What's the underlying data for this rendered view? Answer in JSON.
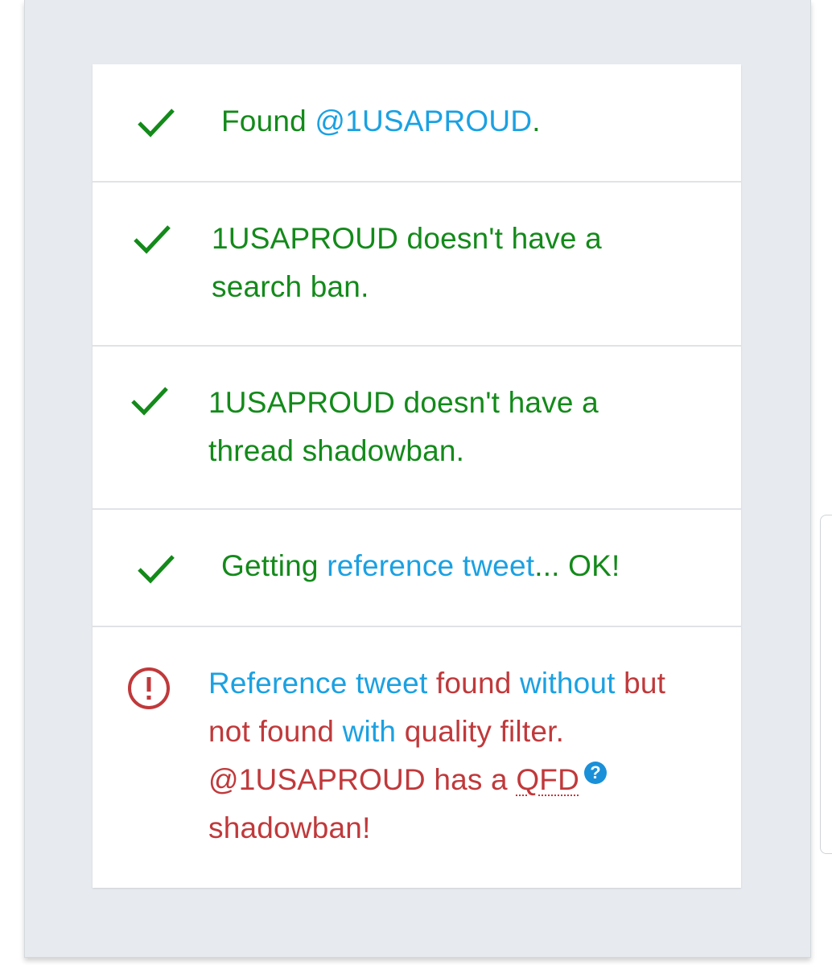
{
  "results": [
    {
      "status": "ok",
      "icon": "check-icon",
      "parts": [
        {
          "text": "Found ",
          "color": "green"
        },
        {
          "text": "@1USAPROUD",
          "color": "blue"
        },
        {
          "text": ".",
          "color": "green"
        }
      ]
    },
    {
      "status": "ok",
      "icon": "check-icon",
      "line1": "1USAPROUD doesn't have a",
      "line2": "search ban."
    },
    {
      "status": "ok",
      "icon": "check-icon",
      "line1": "1USAPROUD doesn't have a",
      "line2": "thread shadowban."
    },
    {
      "status": "ok",
      "icon": "check-icon",
      "parts": [
        {
          "text": "Getting ",
          "color": "green"
        },
        {
          "text": "reference tweet",
          "color": "blue"
        },
        {
          "text": "... OK!",
          "color": "green"
        }
      ]
    },
    {
      "status": "error",
      "icon": "exclamation-circle-icon",
      "reference_tweet": "Reference tweet",
      "found": "found",
      "without": "without",
      "but": "but",
      "not_found": "not found",
      "with": "with",
      "quality_filter": "quality filter.",
      "handle_has_a": "@1USAPROUD has a",
      "qfd": "QFD",
      "help": "?",
      "shadowban": "shadowban!"
    }
  ],
  "colors": {
    "green": "#138a1a",
    "blue": "#1ba1e2",
    "red": "#c0393b",
    "help_bg": "#1a90d9",
    "background": "#e7ebef"
  }
}
